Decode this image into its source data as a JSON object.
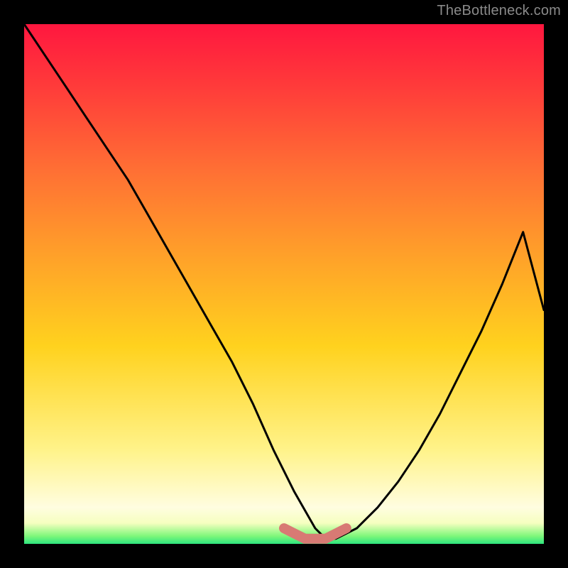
{
  "watermark": "TheBottleneck.com",
  "chart_data": {
    "type": "line",
    "title": "",
    "xlabel": "",
    "ylabel": "",
    "xlim": [
      0,
      100
    ],
    "ylim": [
      0,
      100
    ],
    "series": [
      {
        "name": "bottleneck-curve",
        "x": [
          0,
          4,
          8,
          12,
          16,
          20,
          24,
          28,
          32,
          36,
          40,
          44,
          48,
          52,
          56,
          58,
          60,
          64,
          68,
          72,
          76,
          80,
          84,
          88,
          92,
          96,
          100
        ],
        "values": [
          100,
          94,
          88,
          82,
          76,
          70,
          63,
          56,
          49,
          42,
          35,
          27,
          18,
          10,
          3,
          1,
          1,
          3,
          7,
          12,
          18,
          25,
          33,
          41,
          50,
          60,
          45
        ]
      },
      {
        "name": "flat-bottom-segment",
        "x": [
          50,
          52,
          54,
          56,
          58,
          60,
          62
        ],
        "values": [
          3,
          2,
          1,
          1,
          1,
          2,
          3
        ]
      }
    ],
    "annotations": [],
    "gradient_stops": [
      {
        "pos": 0.0,
        "color": "#ff173f"
      },
      {
        "pos": 0.12,
        "color": "#ff3b3a"
      },
      {
        "pos": 0.28,
        "color": "#ff6f34"
      },
      {
        "pos": 0.45,
        "color": "#ffa229"
      },
      {
        "pos": 0.62,
        "color": "#ffd21e"
      },
      {
        "pos": 0.82,
        "color": "#fff38a"
      },
      {
        "pos": 0.93,
        "color": "#fffde0"
      },
      {
        "pos": 0.96,
        "color": "#f6ffc0"
      },
      {
        "pos": 0.985,
        "color": "#7ef77a"
      },
      {
        "pos": 1.0,
        "color": "#2de57e"
      }
    ],
    "curve_color": "#000000",
    "bottom_segment_color": "#d87a74"
  }
}
